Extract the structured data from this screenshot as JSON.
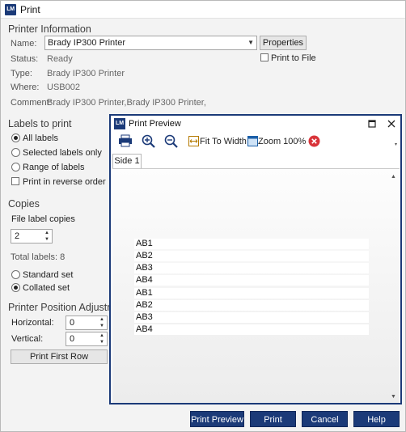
{
  "window": {
    "title": "Print",
    "icon_text": "LM"
  },
  "printer_info": {
    "section_title": "Printer Information",
    "name_label": "Name:",
    "name_value": "Brady IP300 Printer",
    "properties_button": "Properties",
    "print_to_file_label": "Print to File",
    "print_to_file_checked": false,
    "status_label": "Status:",
    "status_value": "Ready",
    "type_label": "Type:",
    "type_value": "Brady IP300 Printer",
    "where_label": "Where:",
    "where_value": "USB002",
    "comment_label": "Comment:",
    "comment_value": "Brady IP300 Printer,Brady IP300 Printer,"
  },
  "labels_to_print": {
    "section_title": "Labels to print",
    "options": [
      {
        "label": "All labels",
        "selected": true
      },
      {
        "label": "Selected labels only",
        "selected": false
      },
      {
        "label": "Range of labels",
        "selected": false
      }
    ],
    "reverse_label": "Print in reverse order",
    "reverse_checked": false
  },
  "copies": {
    "section_title": "Copies",
    "file_label_copies_label": "File label copies",
    "copies_value": "2",
    "total_labels": "Total labels: 8",
    "standard_set": "Standard set",
    "collated_set": "Collated set",
    "collated_selected": true
  },
  "position_adjustment": {
    "section_title": "Printer Position Adjustment",
    "horizontal_label": "Horizontal:",
    "horizontal_value": "0",
    "vertical_label": "Vertical:",
    "vertical_value": "0",
    "print_first_row": "Print First Row"
  },
  "preview": {
    "title": "Print Preview",
    "icon_text": "LM",
    "fit_to_width": "Fit To Width",
    "zoom_100": "Zoom 100%",
    "tab": "Side 1",
    "labels": [
      "AB1",
      "AB2",
      "AB3",
      "AB4",
      "AB1",
      "AB2",
      "AB3",
      "AB4"
    ],
    "colors": {
      "frame": "#1b3a78",
      "close_button": "#d9343a"
    }
  },
  "footer": {
    "print_preview": "Print Preview",
    "print": "Print",
    "cancel": "Cancel",
    "help": "Help"
  },
  "colors": {
    "accent": "#1b3a78"
  }
}
